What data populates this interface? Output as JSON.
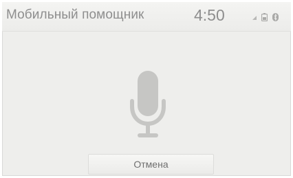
{
  "header": {
    "title": "Мобильный помощник",
    "time": "4:50",
    "status_icons": [
      "signal-icon",
      "battery-icon",
      "bluetooth-icon"
    ]
  },
  "main": {
    "icon": "microphone-icon"
  },
  "footer": {
    "cancel_label": "Отмена"
  },
  "colors": {
    "background": "#eeeeec",
    "text": "#8e8e8e",
    "icon": "#c6c6c4"
  }
}
